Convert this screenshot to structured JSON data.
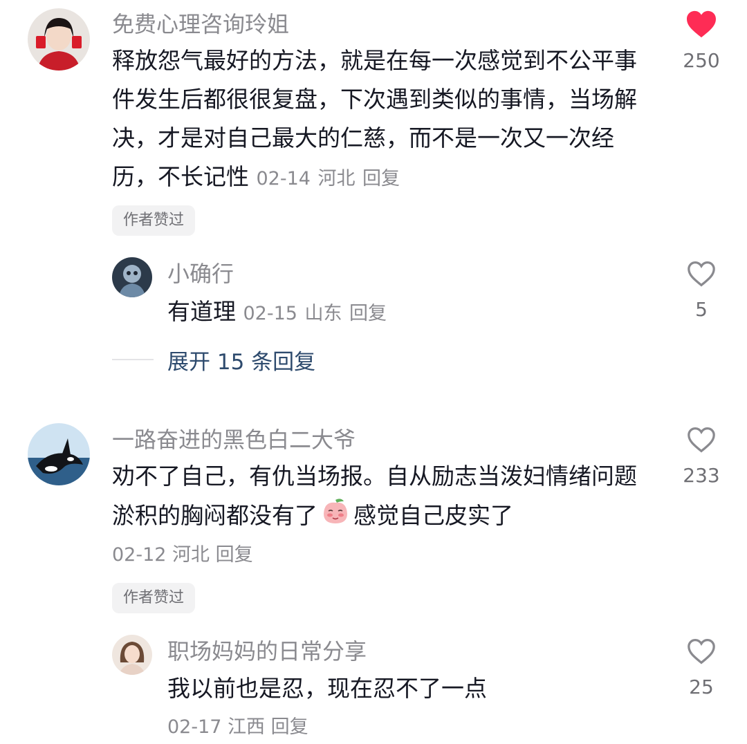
{
  "comments": [
    {
      "username": "免费心理咨询玲姐",
      "text": "释放怨气最好的方法，就是在每一次感觉到不公平事件发生后都很很复盘，下次遇到类似的事情，当场解决，才是对自己最大的仁慈，而不是一次又一次经历，不长记性",
      "date": "02-14",
      "location": "河北",
      "reply_label": "回复",
      "likes": "250",
      "liked": true,
      "badge": "作者赞过",
      "replies": [
        {
          "username": "小确行",
          "text": "有道理",
          "date": "02-15",
          "location": "山东",
          "reply_label": "回复",
          "likes": "5",
          "liked": false
        }
      ],
      "expand_label": "展开 15 条回复"
    },
    {
      "username": "一路奋进的黑色白二大爷",
      "text_part1": "劝不了自己，有仇当场报。自从励志当泼妇情绪问题淤积的胸闷都没有了",
      "sticker": "peach-sticker-icon",
      "text_part2": "感觉自己皮实了",
      "date": "02-12",
      "location": "河北",
      "reply_label": "回复",
      "likes": "233",
      "liked": false,
      "badge": "作者赞过",
      "replies": [
        {
          "username": "职场妈妈的日常分享",
          "text": "我以前也是忍，现在忍不了一点",
          "date": "02-17",
          "location": "江西",
          "reply_label": "回复",
          "likes": "25",
          "liked": false
        }
      ]
    }
  ],
  "colors": {
    "heart_liked": "#fe2c55",
    "heart_outline": "#8a8a8f",
    "expand_text": "#2d4a6d"
  }
}
